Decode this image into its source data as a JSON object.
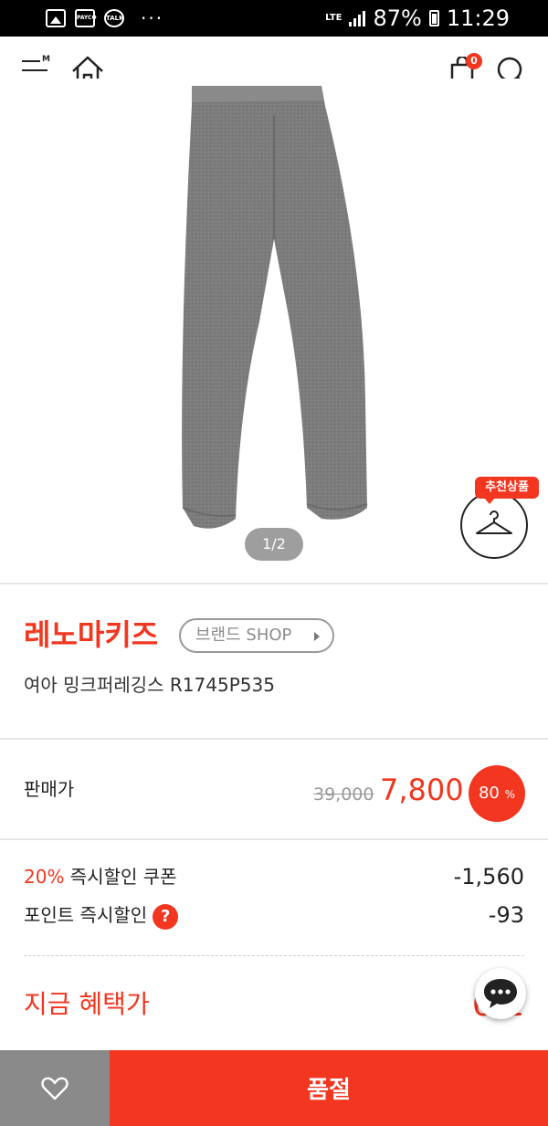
{
  "status_bar": {
    "network": "LTE",
    "battery": "87%",
    "time": "11:29",
    "more": "···",
    "payco_label": "PAYCO",
    "talk_label": "TALK"
  },
  "header": {
    "menu_badge": "M",
    "cart_count": "0"
  },
  "gallery": {
    "pager": "1/2",
    "recommend_label": "추천상품"
  },
  "product": {
    "brand": "레노마키즈",
    "brand_shop_label": "브랜드 SHOP",
    "title": "여아 밍크퍼레깅스 R1745P535"
  },
  "price": {
    "label": "판매가",
    "original": "39,000",
    "sale": "7,800",
    "discount_number": "80",
    "discount_unit": "%"
  },
  "benefits": {
    "coupon_pct": "20%",
    "coupon_label": " 즉시할인 쿠폰",
    "coupon_value": "-1,560",
    "point_label": "포인트 즉시할인",
    "point_help": "?",
    "point_value": "-93",
    "now_label": "지금 혜택가",
    "now_value": "6,1"
  },
  "bottom_bar": {
    "soldout_label": "품절"
  },
  "colors": {
    "accent": "#f2361f",
    "gray_button": "#8a8a8a"
  },
  "icons": [
    "menu-icon",
    "home-icon",
    "cart-icon",
    "search-icon",
    "hanger-icon",
    "chat-icon",
    "heart-icon"
  ]
}
